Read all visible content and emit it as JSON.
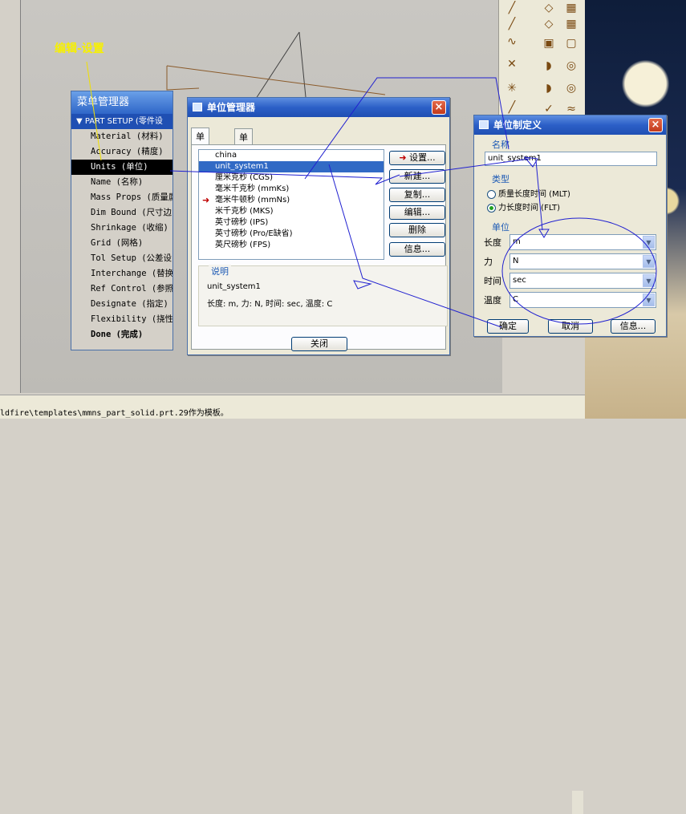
{
  "edit_label": "编辑-设置",
  "status_bar": {
    "message": "ldfire\\templates\\mmns_part_solid.prt.29作为模板。"
  },
  "menu_manager": {
    "title": "菜单管理器",
    "header": "PART SETUP (零件设",
    "items": [
      "Material (材料)",
      "Accuracy (精度)",
      "Units (单位)",
      "Name (名称)",
      "Mass Props (质量属",
      "Dim Bound (尺寸边",
      "Shrinkage (收缩)",
      "Grid (网格)",
      "Tol Setup (公差设",
      "Interchange (替换",
      "Ref Control (参照",
      "Designate (指定)",
      "Flexibility (挠性",
      "Done (完成)"
    ],
    "selected_index": 2
  },
  "unit_manager": {
    "title": "单位管理器",
    "close_icon": "×",
    "tabs": [
      "单位制",
      "单位"
    ],
    "systems": [
      "china",
      "unit_system1",
      "厘米克秒 (CGS)",
      "毫米千克秒 (mmKs)",
      "毫米牛顿秒 (mmNs)",
      "米千克秒 (MKS)",
      "英寸磅秒 (IPS)",
      "英寸磅秒 (Pro/E缺省)",
      "英尺磅秒 (FPS)"
    ],
    "selected_index": 1,
    "current_index": 4,
    "buttons": {
      "set": "设置...",
      "new": "新建...",
      "copy": "复制...",
      "edit": "编辑...",
      "delete": "删除",
      "info": "信息..."
    },
    "description_label": "说明",
    "description_name": "unit_system1",
    "description_text": "长度: m, 力: N, 时间: sec, 温度: C",
    "close_button": "关闭"
  },
  "unit_definition": {
    "title": "单位制定义",
    "close_icon": "×",
    "name_label": "名称",
    "name_value": "unit_system1",
    "type_label": "类型",
    "type_options": [
      "质量长度时间 (MLT)",
      "力长度时间 (FLT)"
    ],
    "type_selected": 1,
    "units_label": "单位",
    "rows": [
      {
        "label": "长度",
        "value": "m"
      },
      {
        "label": "力",
        "value": "N"
      },
      {
        "label": "时间",
        "value": "sec"
      },
      {
        "label": "温度",
        "value": "C"
      }
    ],
    "buttons": {
      "ok": "确定",
      "cancel": "取消",
      "info": "信息..."
    }
  },
  "colors": {
    "title_blue": "#2c5fc7",
    "selection_blue": "#316ac5",
    "annotation_blue": "#2020d0",
    "label_yellow": "#f7f000",
    "menu_selected": "#000000"
  }
}
